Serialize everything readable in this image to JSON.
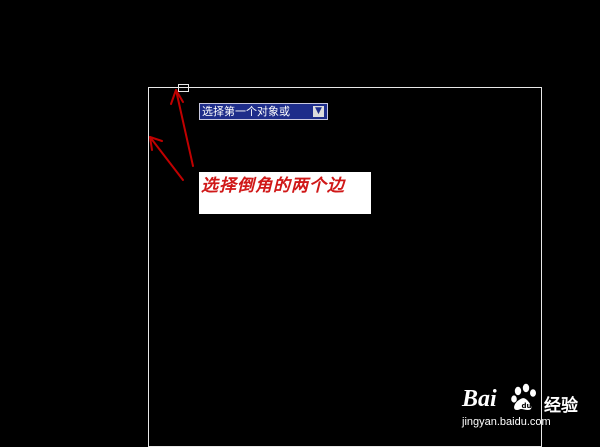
{
  "canvas": {
    "background": "#000000",
    "drawing_color": "#e8e8e8"
  },
  "tooltip": {
    "prompt_text": "选择第一个对象或",
    "dropdown_icon": "down-arrow-icon",
    "background": "#1e2d8a"
  },
  "annotation": {
    "text": "选择倒角的两个边",
    "text_color": "#d01818"
  },
  "arrows": {
    "color": "#c00000",
    "count": 2
  },
  "watermark": {
    "brand_left": "Bai",
    "brand_right": "经验",
    "url": "jingyan.baidu.com",
    "paw_icon": "baidu-paw-icon"
  }
}
